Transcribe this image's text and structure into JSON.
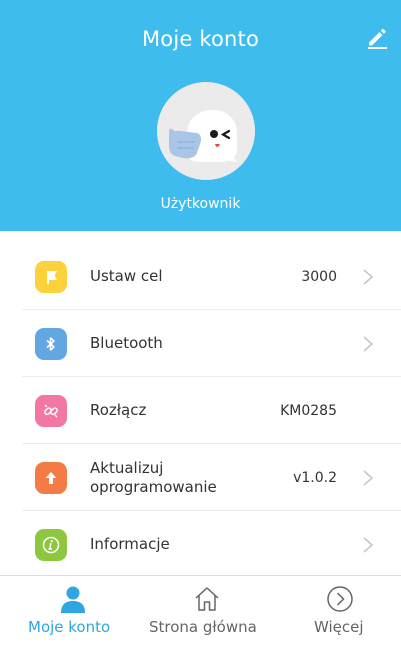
{
  "header": {
    "title": "Moje konto",
    "username": "Użytkownik",
    "background_color": "#3fbcee",
    "edit_icon": "pencil-icon"
  },
  "menu": {
    "items": [
      {
        "label": "Ustaw cel",
        "value": "3000",
        "icon": "flag-icon",
        "icon_color": "#fbd13c",
        "has_chevron": true
      },
      {
        "label": "Bluetooth",
        "value": "",
        "icon": "bluetooth-icon",
        "icon_color": "#62a6e2",
        "has_chevron": true
      },
      {
        "label": "Rozłącz",
        "value": "KM0285",
        "icon": "unlink-icon",
        "icon_color": "#f277a5",
        "has_chevron": false
      },
      {
        "label_line1": "Aktualizuj",
        "label_line2": "oprogramowanie",
        "value": "v1.0.2",
        "icon": "upload-arrow-icon",
        "icon_color": "#f57b45",
        "has_chevron": true
      },
      {
        "label": "Informacje",
        "value": "",
        "icon": "info-icon",
        "icon_color": "#8dc73f",
        "has_chevron": true
      }
    ]
  },
  "bottom_nav": {
    "items": [
      {
        "label": "Moje konto",
        "icon": "person-icon",
        "active": true
      },
      {
        "label": "Strona główna",
        "icon": "home-icon",
        "active": false
      },
      {
        "label": "Więcej",
        "icon": "circle-chevron-right-icon",
        "active": false
      }
    ],
    "active_color": "#2fa6e0",
    "inactive_color": "#666666"
  }
}
